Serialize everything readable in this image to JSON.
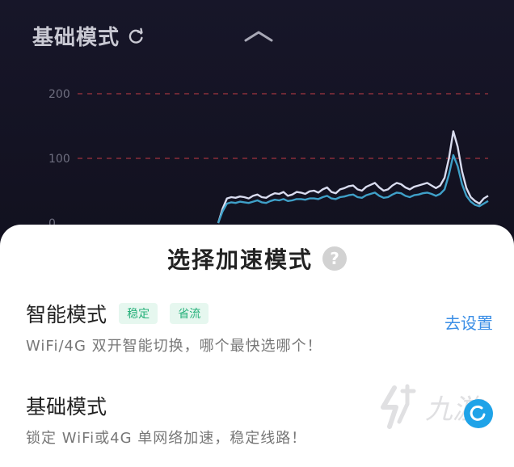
{
  "header": {
    "title": "基础模式",
    "refresh_icon": "refresh-icon",
    "collapse_icon": "chevron-up-icon"
  },
  "chart_data": {
    "type": "line",
    "y_ticks": [
      "200",
      "100",
      "0"
    ],
    "ylim": [
      0,
      200
    ],
    "grid": true,
    "reference_lines": [
      {
        "value": 200,
        "color": "#8a2e3b",
        "style": "dashed"
      },
      {
        "value": 100,
        "color": "#8a2e3b",
        "style": "dashed"
      }
    ],
    "x": [
      0,
      1,
      2,
      3,
      4,
      5,
      6,
      7,
      8,
      9,
      10,
      11,
      12,
      13,
      14,
      15,
      16,
      17,
      18,
      19,
      20,
      21,
      22,
      23,
      24,
      25,
      26,
      27,
      28,
      29,
      30,
      31,
      32,
      33,
      34,
      35,
      36,
      37,
      38,
      39,
      40,
      41,
      42,
      43,
      44,
      45,
      46,
      47,
      48,
      49,
      50,
      51,
      52,
      53,
      54,
      55,
      56,
      57,
      58,
      59,
      60,
      61,
      62
    ],
    "series": [
      {
        "color": "#d9dcef",
        "values": [
          0,
          22,
          38,
          40,
          39,
          41,
          40,
          38,
          42,
          44,
          40,
          39,
          43,
          46,
          45,
          48,
          42,
          44,
          48,
          47,
          45,
          49,
          50,
          47,
          52,
          55,
          48,
          46,
          52,
          54,
          57,
          58,
          52,
          50,
          56,
          59,
          62,
          55,
          50,
          52,
          58,
          62,
          60,
          55,
          52,
          56,
          58,
          60,
          62,
          58,
          54,
          58,
          70,
          100,
          142,
          118,
          80,
          54,
          40,
          34,
          30,
          38,
          42
        ]
      },
      {
        "color": "#3fa0c8",
        "values": [
          0,
          18,
          30,
          32,
          31,
          33,
          32,
          31,
          33,
          35,
          32,
          31,
          34,
          36,
          35,
          37,
          34,
          35,
          37,
          37,
          36,
          38,
          38,
          37,
          40,
          42,
          38,
          37,
          40,
          41,
          43,
          44,
          40,
          39,
          43,
          45,
          47,
          42,
          39,
          40,
          44,
          47,
          46,
          42,
          40,
          43,
          44,
          46,
          47,
          45,
          42,
          45,
          52,
          75,
          105,
          88,
          60,
          42,
          33,
          28,
          26,
          30,
          34
        ]
      }
    ]
  },
  "sheet": {
    "title": "选择加速模式",
    "help_icon": "help-icon",
    "help_glyph": "?",
    "smart_mode": {
      "name": "智能模式",
      "tags": [
        "稳定",
        "省流"
      ],
      "description": "WiFi/4G 双开智能切换，哪个最快选哪个！",
      "action": "去设置"
    },
    "basic_mode": {
      "name": "基础模式",
      "description": "锁定 WiFi或4G 单网络加速，稳定线路！",
      "selected_icon": "selected-check-icon"
    }
  },
  "watermark": {
    "text": "九游",
    "icon": "jiuyou-logo-icon"
  }
}
